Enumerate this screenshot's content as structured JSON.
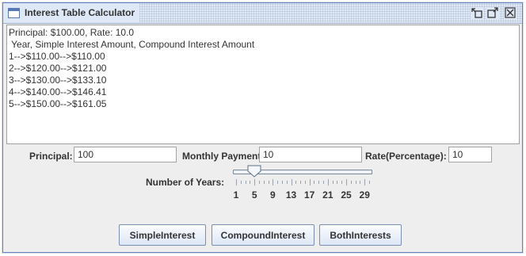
{
  "window": {
    "title": "Interest Table Calculator",
    "accent": "#6382bf"
  },
  "output": {
    "lines": [
      "Principal: $100.00, Rate: 10.0",
      " Year, Simple Interest Amount, Compound Interest Amount",
      "1-->$110.00-->$110.00",
      "2-->$120.00-->$121.00",
      "3-->$130.00-->$133.10",
      "4-->$140.00-->$146.41",
      "5-->$150.00-->$161.05"
    ]
  },
  "form": {
    "principal_label": "Principal:",
    "principal_value": "100",
    "monthly_label": "Monthly Payment:",
    "monthly_value": "10",
    "rate_label": "Rate(Percentage):",
    "rate_value": "10",
    "years_label": "Number of Years:",
    "years_value": 5,
    "years_min": 1,
    "years_max": 30,
    "tick_labels": [
      "1",
      "5",
      "9",
      "13",
      "17",
      "21",
      "25",
      "29"
    ]
  },
  "buttons": {
    "simple": "SimpleInterest",
    "compound": "CompoundInterest",
    "both": "BothInterests"
  }
}
